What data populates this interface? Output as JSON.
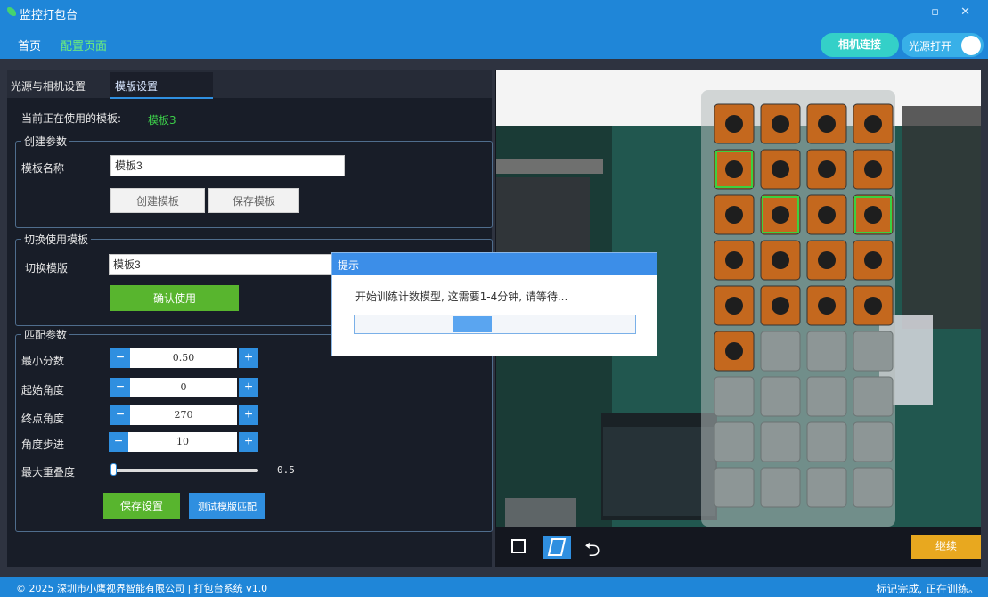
{
  "window": {
    "title": "监控打包台",
    "controls": "— ▫ ✕"
  },
  "menu": {
    "home": "首页",
    "config": "配置页面"
  },
  "header": {
    "camera_connect": "相机连接",
    "light_toggle_label": "光源打开",
    "light_on": true
  },
  "tabs": {
    "light_camera": "光源与相机设置",
    "template": "模版设置"
  },
  "current_template": {
    "label": "当前正在使用的模板:",
    "value": "模板3"
  },
  "create_group": {
    "title": "创建参数",
    "name_label": "模板名称",
    "name_value": "模板3",
    "create_button": "创建模板",
    "save_button": "保存模板"
  },
  "switch_group": {
    "title": "切换使用模板",
    "switch_label": "切换模版",
    "switch_value": "模板3",
    "confirm_button": "确认使用"
  },
  "match_group": {
    "title": "匹配参数",
    "min_score": {
      "label": "最小分数",
      "value": "0.50"
    },
    "start_angle": {
      "label": "起始角度",
      "value": "0"
    },
    "end_angle": {
      "label": "终点角度",
      "value": "270"
    },
    "angle_step": {
      "label": "角度步进",
      "value": "10"
    },
    "max_overlap": {
      "label": "最大重叠度",
      "value": "0.5",
      "fraction": 0.0
    },
    "save_button": "保存设置",
    "test_button": "测试模版匹配"
  },
  "dialog": {
    "title": "提示",
    "message": "开始训练计数模型, 这需要1-4分钟, 请等待...",
    "progress_chunk_start": 0.35,
    "progress_chunk_end": 0.49
  },
  "camera": {
    "grid_cols": 4,
    "filled_counts": [
      6,
      5,
      5,
      5
    ],
    "highlighted": [
      [
        1,
        0
      ],
      [
        2,
        1
      ],
      [
        2,
        3
      ]
    ]
  },
  "toolbar": {
    "undo_icon": "⮌",
    "continue_button": "继续"
  },
  "footer": {
    "left": "© 2025 深圳市小鹰视界智能有限公司 | 打包台系统 v1.0",
    "right": "标记完成, 正在训练。"
  },
  "colors": {
    "accent": "#1f86d8",
    "green": "#58b52e",
    "teal": "#34d0c8",
    "orange": "#e8a81f"
  }
}
